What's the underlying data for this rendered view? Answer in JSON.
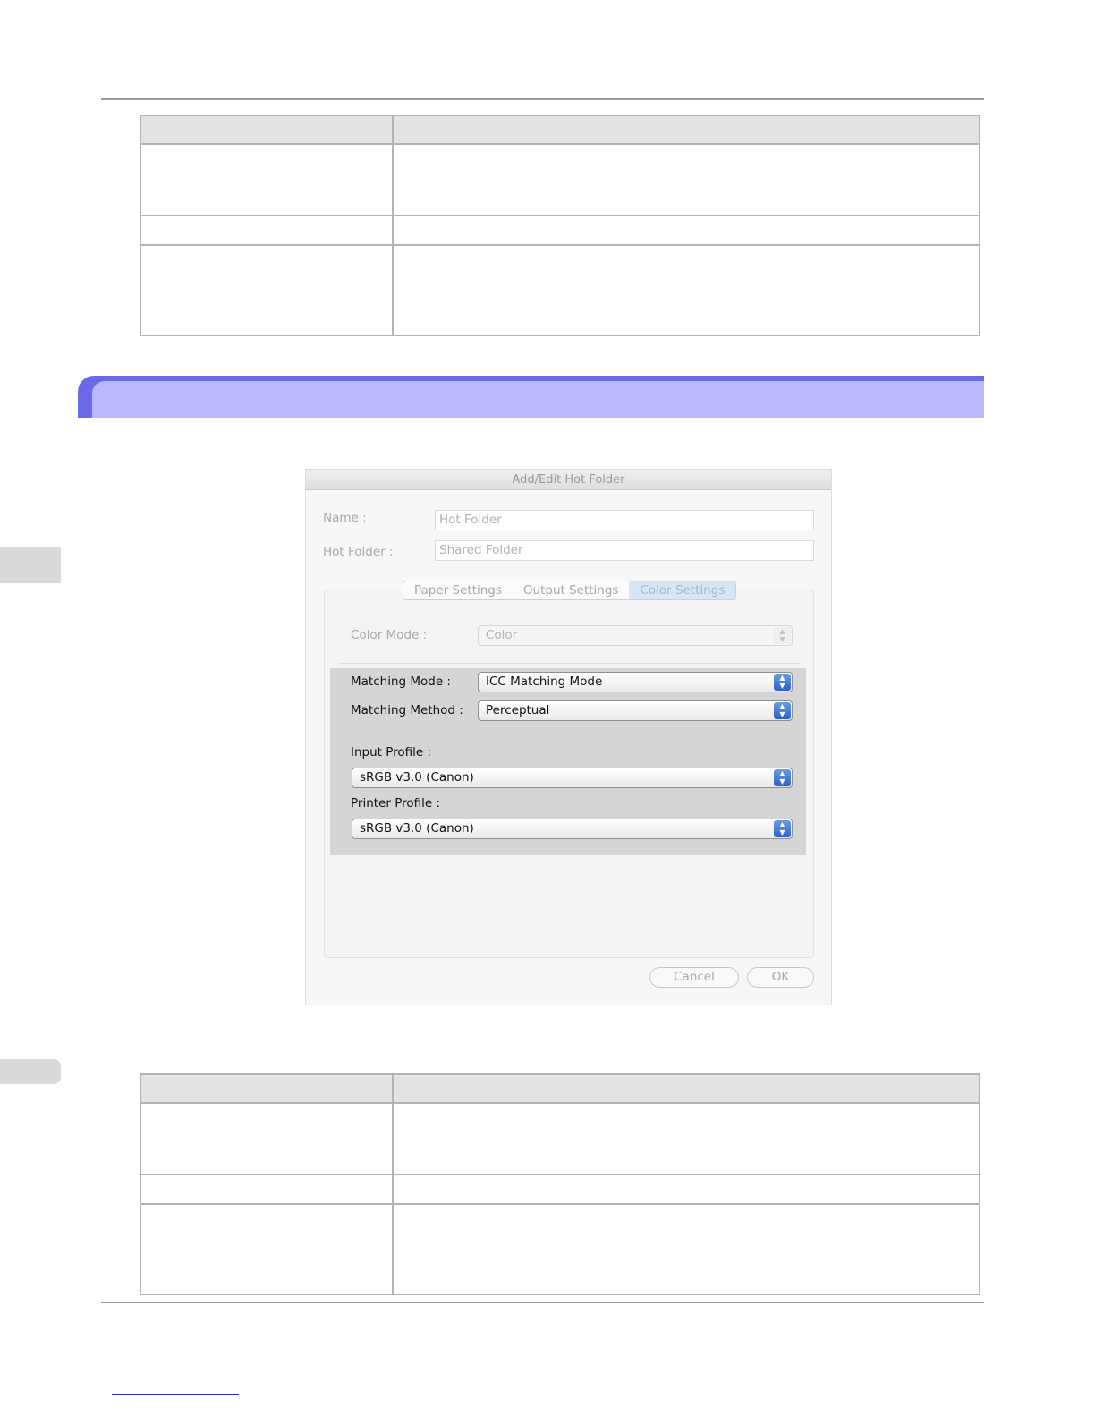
{
  "dialog": {
    "title": "Add/Edit Hot Folder",
    "name_label": "Name :",
    "name_value": "Hot Folder",
    "hotfolder_label": "Hot Folder :",
    "hotfolder_value": "Shared Folder",
    "tabs": [
      {
        "label": "Paper Settings",
        "active": false
      },
      {
        "label": "Output Settings",
        "active": false
      },
      {
        "label": "Color Settings",
        "active": true
      }
    ],
    "color_mode_label": "Color Mode :",
    "color_mode_value": "Color",
    "matching_mode_label": "Matching Mode :",
    "matching_mode_value": "ICC Matching Mode",
    "matching_method_label": "Matching Method :",
    "matching_method_value": "Perceptual",
    "input_profile_label": "Input Profile :",
    "input_profile_value": "sRGB v3.0 (Canon)",
    "printer_profile_label": "Printer Profile :",
    "printer_profile_value": "sRGB v3.0 (Canon)",
    "cancel_label": "Cancel",
    "ok_label": "OK"
  },
  "colors": {
    "section_band_outer": "#6a6ae8",
    "section_band_inner": "#b9b9fb",
    "active_tab": "#d7e6f7",
    "popup_stepper": "#2a63c7"
  }
}
